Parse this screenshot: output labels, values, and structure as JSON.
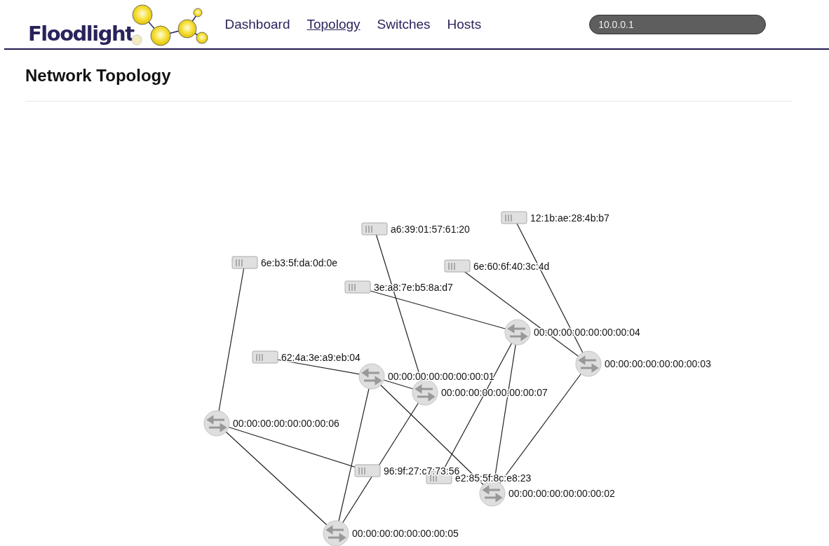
{
  "header": {
    "logo": "Floodlight",
    "nav": [
      {
        "label": "Dashboard",
        "selected": false
      },
      {
        "label": "Topology",
        "selected": true
      },
      {
        "label": "Switches",
        "selected": false
      },
      {
        "label": "Hosts",
        "selected": false
      }
    ],
    "search": {
      "value": "10.0.0.1"
    }
  },
  "page": {
    "title": "Network Topology"
  },
  "topology": {
    "nodes": [
      {
        "kind": "host",
        "label": "6e:b3:5f:da:0d:0e"
      },
      {
        "kind": "host",
        "label": "a6:39:01:57:61:20"
      },
      {
        "kind": "host",
        "label": "12:1b:ae:28:4b:b7"
      },
      {
        "kind": "host",
        "label": "6e:60:6f:40:3c:4d"
      },
      {
        "kind": "host",
        "label": "3e:a8:7e:b5:8a:d7"
      },
      {
        "kind": "host",
        "label": "62:4a:3e:a9:eb:04"
      },
      {
        "kind": "host",
        "label": "96:9f:27:c7:73:56"
      },
      {
        "kind": "host",
        "label": "e2:85:5f:8c:e8:23"
      },
      {
        "kind": "switch",
        "label": "00:00:00:00:00:00:00:01"
      },
      {
        "kind": "switch",
        "label": "00:00:00:00:00:00:00:07"
      },
      {
        "kind": "switch",
        "label": "00:00:00:00:00:00:00:04"
      },
      {
        "kind": "switch",
        "label": "00:00:00:00:00:00:00:03"
      },
      {
        "kind": "switch",
        "label": "00:00:00:00:00:00:00:06"
      },
      {
        "kind": "switch",
        "label": "00:00:00:00:00:00:00:02"
      },
      {
        "kind": "switch",
        "label": "00:00:00:00:00:00:00:05"
      }
    ]
  }
}
